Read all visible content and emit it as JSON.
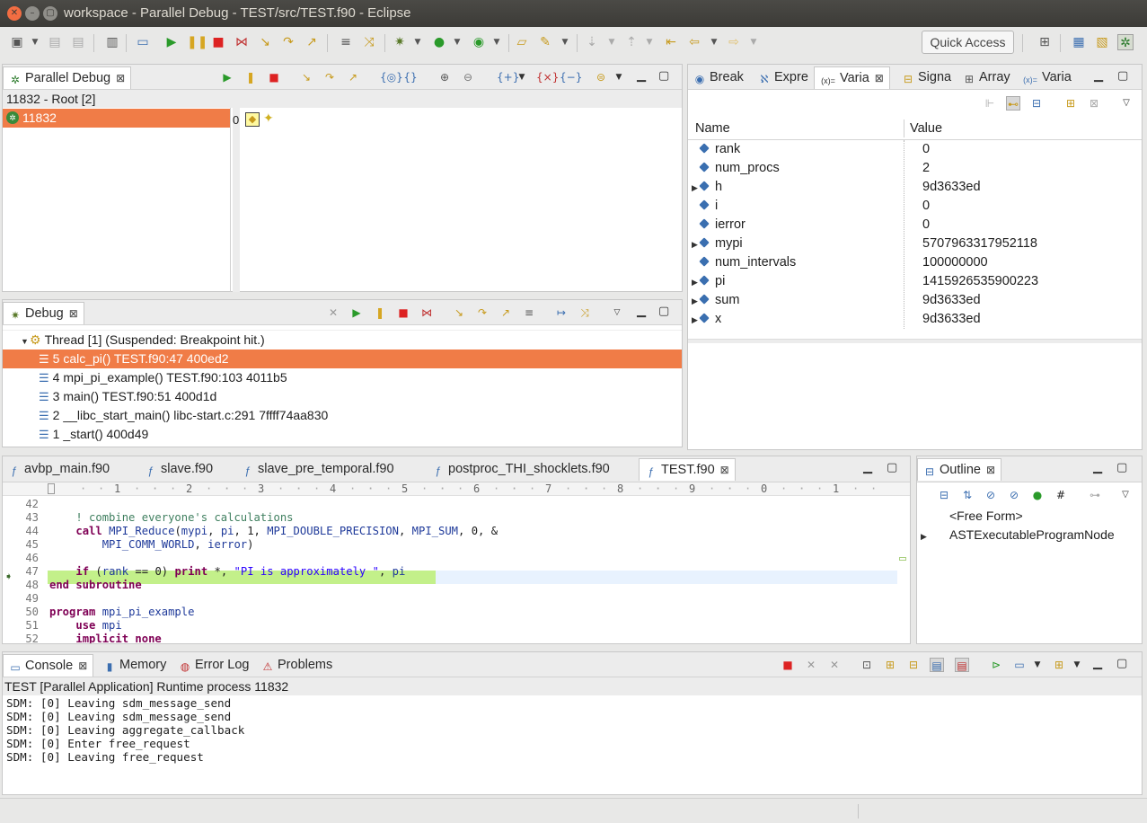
{
  "window": {
    "title": "workspace - Parallel Debug - TEST/src/TEST.f90 - Eclipse"
  },
  "toolbar": {
    "quick_access": "Quick Access"
  },
  "parallel_debug": {
    "tab": "Parallel Debug",
    "root_label": "11832 - Root [2]",
    "job": "11832",
    "set_label": "0"
  },
  "debug": {
    "tab": "Debug",
    "thread": "Thread [1] (Suspended: Breakpoint hit.)",
    "frames": [
      "5 calc_pi() TEST.f90:47 400ed2",
      "4 mpi_pi_example() TEST.f90:103 4011b5",
      "3 main() TEST.f90:51 400d1d",
      "2 __libc_start_main() libc-start.c:291 7ffff74aa830",
      "1 _start() 400d49"
    ]
  },
  "right_tabs": [
    "Break",
    "Expre",
    "Varia",
    "Signa",
    "Array",
    "Varia"
  ],
  "variables": {
    "col_name": "Name",
    "col_value": "Value",
    "rows": [
      {
        "name": "rank",
        "value": "0",
        "expandable": false
      },
      {
        "name": "num_procs",
        "value": "2",
        "expandable": false
      },
      {
        "name": "h",
        "value": "9d3633ed",
        "expandable": true
      },
      {
        "name": "i",
        "value": "0",
        "expandable": false
      },
      {
        "name": "ierror",
        "value": "0",
        "expandable": false
      },
      {
        "name": "mypi",
        "value": "5707963317952118",
        "expandable": true
      },
      {
        "name": "num_intervals",
        "value": "100000000",
        "expandable": false
      },
      {
        "name": "pi",
        "value": "1415926535900223",
        "expandable": true
      },
      {
        "name": "sum",
        "value": "9d3633ed",
        "expandable": true
      },
      {
        "name": "x",
        "value": "9d3633ed",
        "expandable": true
      }
    ]
  },
  "editor": {
    "tabs": [
      "avbp_main.f90",
      "slave.f90",
      "slave_pre_temporal.f90",
      "postproc_THI_shocklets.f90",
      "TEST.f90"
    ],
    "ruler": [
      "1",
      "2",
      "3",
      "4",
      "5",
      "6",
      "7",
      "8",
      "9",
      "0",
      "1"
    ],
    "lines": [
      {
        "n": "42",
        "html": ""
      },
      {
        "n": "43",
        "html": "    <span class='cm'>! combine everyone's calculations</span>"
      },
      {
        "n": "44",
        "html": "    <span class='kw'>call</span> <span class='fn'>MPI_Reduce</span>(<span class='fn'>mypi</span>, <span class='fn'>pi</span>, 1, <span class='fn'>MPI_DOUBLE_PRECISION</span>, <span class='fn'>MPI_SUM</span>, 0, &amp;"
      },
      {
        "n": "45",
        "html": "        <span class='fn'>MPI_COMM_WORLD</span>, <span class='fn'>ierror</span>)"
      },
      {
        "n": "46",
        "html": ""
      },
      {
        "n": "47",
        "html": "    <span class='kw'>if</span> (<span class='fn'>rank</span> == 0) <span class='kw'>print</span> *, <span class='str'>\"PI is approximately \"</span>, <span class='fn'>pi</span>"
      },
      {
        "n": "48",
        "html": "<span class='kw'>end subroutine</span>"
      },
      {
        "n": "49",
        "html": ""
      },
      {
        "n": "50",
        "html": "<span class='kw'>program</span> <span class='fn'>mpi_pi_example</span>"
      },
      {
        "n": "51",
        "html": "    <span class='kw'>use</span> <span class='fn'>mpi</span>"
      },
      {
        "n": "52",
        "html": "    <span class='kw'>implicit none</span>"
      }
    ]
  },
  "outline": {
    "tab": "Outline",
    "items": [
      "<Free Form>",
      "ASTExecutableProgramNode"
    ]
  },
  "console": {
    "tabs": [
      "Console",
      "Memory",
      "Error Log",
      "Problems"
    ],
    "header": "TEST [Parallel Application] Runtime process 11832",
    "lines": [
      "SDM: [0] Leaving sdm_message_send",
      "SDM: [0] Leaving sdm_message_send",
      "SDM: [0] Leaving aggregate_callback",
      "SDM: [0] Enter free_request",
      "SDM: [0] Leaving free_request"
    ]
  },
  "colors": {
    "selection": "#f07c47",
    "current_line": "#c3f08a",
    "title_bg": "#3c3b37"
  }
}
